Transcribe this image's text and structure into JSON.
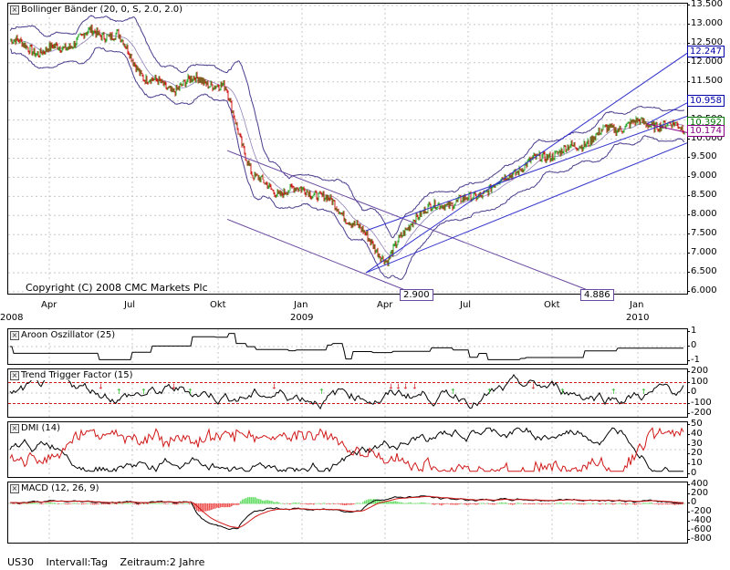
{
  "colors": {
    "band": "#4b3c8c",
    "channel": "#3333cc",
    "channel_down": "#6a4aa0",
    "up_candle": "#2ea82e",
    "down_candle": "#d01818",
    "level_red": "#d01818",
    "macd_hist_pos": "#66dd66",
    "macd_hist_neg": "#ee5555"
  },
  "main": {
    "title": "Bollinger Bänder (20, 0, S, 2.0, 2.0)",
    "copyright": "Copyright (C) 2008 CMC Markets Plc",
    "y_ticks": [
      "13.500",
      "13.000",
      "12.500",
      "12.000",
      "11.500",
      "11.000",
      "10.500",
      "10.000",
      "9.500",
      "9.000",
      "8.500",
      "8.000",
      "7.500",
      "7.000",
      "6.500",
      "6.000"
    ],
    "price_labels": [
      {
        "text": "12.247",
        "color": "#0000aa"
      },
      {
        "text": "10.958",
        "color": "#0000aa"
      },
      {
        "text": "10.392",
        "color": "#007700"
      },
      {
        "text": "10.174",
        "color": "#880088"
      }
    ],
    "point_labels": [
      "2.900",
      "4.886"
    ]
  },
  "x_axis": {
    "months": [
      "Apr",
      "Jul",
      "Okt",
      "Jan",
      "Apr",
      "Jul",
      "Okt",
      "Jan"
    ],
    "years": [
      "2008",
      "2009",
      "2010"
    ]
  },
  "aroon": {
    "title": "Aroon Oszillator (25)",
    "y_ticks": [
      "1",
      "0",
      "-1"
    ]
  },
  "ttf": {
    "title": "Trend Trigger Factor (15)",
    "y_ticks": [
      "200",
      "100",
      "0",
      "-100",
      "-200"
    ]
  },
  "dmi": {
    "title": "DMI (14)",
    "y_ticks": [
      "50",
      "40",
      "30",
      "20",
      "10",
      "0"
    ]
  },
  "macd": {
    "title": "MACD (12, 26, 9)",
    "y_ticks": [
      "400",
      "200",
      "0",
      "-200",
      "-400",
      "-600",
      "-800"
    ]
  },
  "footer": {
    "symbol": "US30",
    "interval": "Intervall:Tag",
    "period": "Zeitraum:2 Jahre"
  },
  "chart_data": [
    {
      "type": "line",
      "title": "Bollinger Bänder (20, 0, S, 2.0, 2.0)",
      "x": [
        "2008-01",
        "2008-02",
        "2008-03",
        "2008-04",
        "2008-05",
        "2008-06",
        "2008-07",
        "2008-08",
        "2008-09",
        "2008-10",
        "2008-11",
        "2008-12",
        "2009-01",
        "2009-02",
        "2009-03",
        "2009-04",
        "2009-05",
        "2009-06",
        "2009-07",
        "2009-08",
        "2009-09",
        "2009-10",
        "2009-11",
        "2009-12",
        "2010-01",
        "2010-02"
      ],
      "series": [
        {
          "values": [
            12.6,
            12.3,
            12.4,
            12.8,
            12.7,
            11.6,
            11.3,
            11.6,
            11.3,
            9.0,
            8.6,
            8.7,
            8.3,
            7.6,
            6.8,
            8.0,
            8.3,
            8.4,
            8.8,
            9.3,
            9.6,
            9.8,
            10.2,
            10.4,
            10.4,
            10.3
          ]
        }
      ],
      "ylim": [
        6000,
        13500
      ],
      "channel_labels": [
        "12.247",
        "10.958",
        "10.392",
        "10.174"
      ],
      "point_labels": [
        "2.900",
        "4.886"
      ]
    },
    {
      "type": "line",
      "title": "Aroon Oszillator (25)",
      "ylim": [
        -1,
        1
      ]
    },
    {
      "type": "line",
      "title": "Trend Trigger Factor (15)",
      "ylim": [
        -200,
        200
      ],
      "levels": [
        100,
        -100
      ]
    },
    {
      "type": "line",
      "title": "DMI (14)",
      "ylim": [
        0,
        50
      ]
    },
    {
      "type": "line",
      "title": "MACD (12, 26, 9)",
      "ylim": [
        -800,
        400
      ]
    }
  ]
}
